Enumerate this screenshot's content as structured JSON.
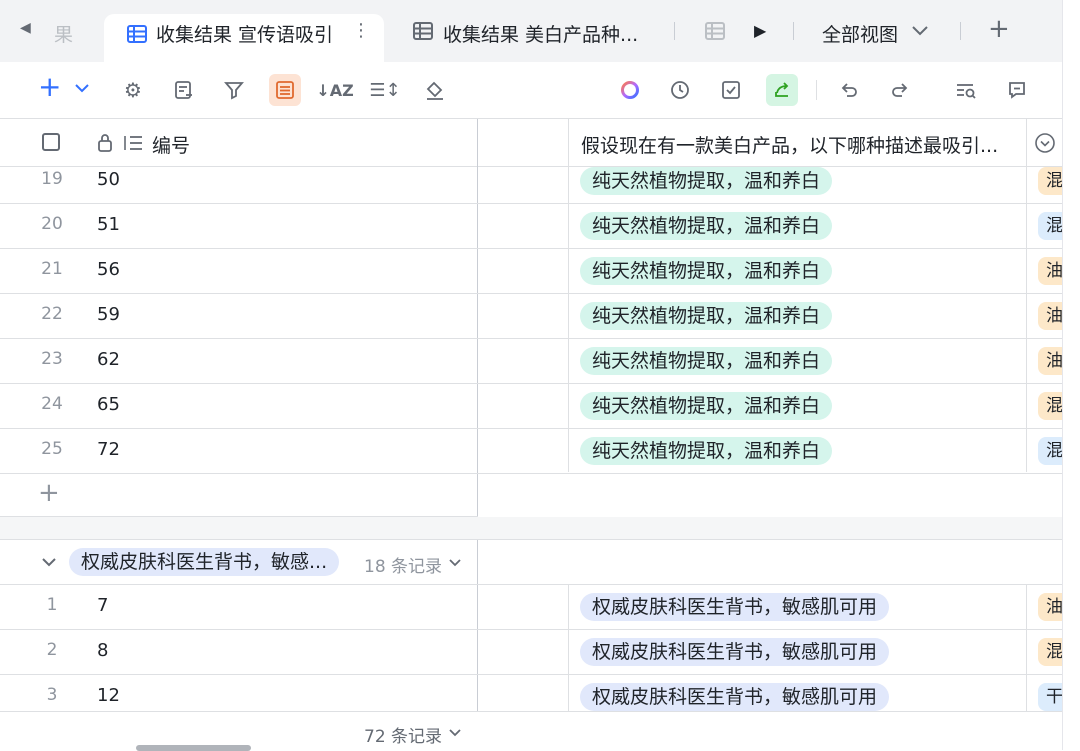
{
  "tabs": {
    "prev_tab_partial": "果",
    "active_tab": "收集结果 宣传语吸引",
    "second_tab": "收集结果 美白产品种...",
    "all_views": "全部视图"
  },
  "grid": {
    "header_id_label": "编号",
    "header_question": "假设现在有一款美白产品，以下哪种描述最吸引...",
    "rows_group1": [
      {
        "n": "19",
        "id": "50",
        "tag": "纯天然植物提取，温和养白",
        "side": "混"
      },
      {
        "n": "20",
        "id": "51",
        "tag": "纯天然植物提取，温和养白",
        "side": "混"
      },
      {
        "n": "21",
        "id": "56",
        "tag": "纯天然植物提取，温和养白",
        "side": "油"
      },
      {
        "n": "22",
        "id": "59",
        "tag": "纯天然植物提取，温和养白",
        "side": "油"
      },
      {
        "n": "23",
        "id": "62",
        "tag": "纯天然植物提取，温和养白",
        "side": "油"
      },
      {
        "n": "24",
        "id": "65",
        "tag": "纯天然植物提取，温和养白",
        "side": "混"
      },
      {
        "n": "25",
        "id": "72",
        "tag": "纯天然植物提取，温和养白",
        "side": "混"
      }
    ],
    "group2": {
      "label": "权威皮肤科医生背书，敏感...",
      "count": "18 条记录"
    },
    "rows_group2": [
      {
        "n": "1",
        "id": "7",
        "tag": "权威皮肤科医生背书，敏感肌可用",
        "side": "油"
      },
      {
        "n": "2",
        "id": "8",
        "tag": "权威皮肤科医生背书，敏感肌可用",
        "side": "混"
      },
      {
        "n": "3",
        "id": "12",
        "tag": "权威皮肤科医生背书，敏感肌可用",
        "side": "干"
      }
    ],
    "footer_count": "72 条记录"
  },
  "colors": {
    "accent": "#3370ff",
    "tag_green": "#d5f5ec",
    "tag_blue": "#e1e8fb",
    "side_orange": "#fde8c9",
    "side_blue": "#dcecfc"
  },
  "icons": [
    "table-icon",
    "more-vertical-icon",
    "play-icon",
    "chevron-down-icon",
    "plus-icon",
    "gear-icon",
    "form-icon",
    "filter-icon",
    "list-icon",
    "sort-icon",
    "row-height-icon",
    "paint-bucket-icon",
    "ai-ring-icon",
    "history-icon",
    "check-square-icon",
    "share-icon",
    "undo-icon",
    "redo-icon",
    "search-icon",
    "comment-icon",
    "lock-icon",
    "field-list-icon",
    "dropdown-circle-icon"
  ]
}
